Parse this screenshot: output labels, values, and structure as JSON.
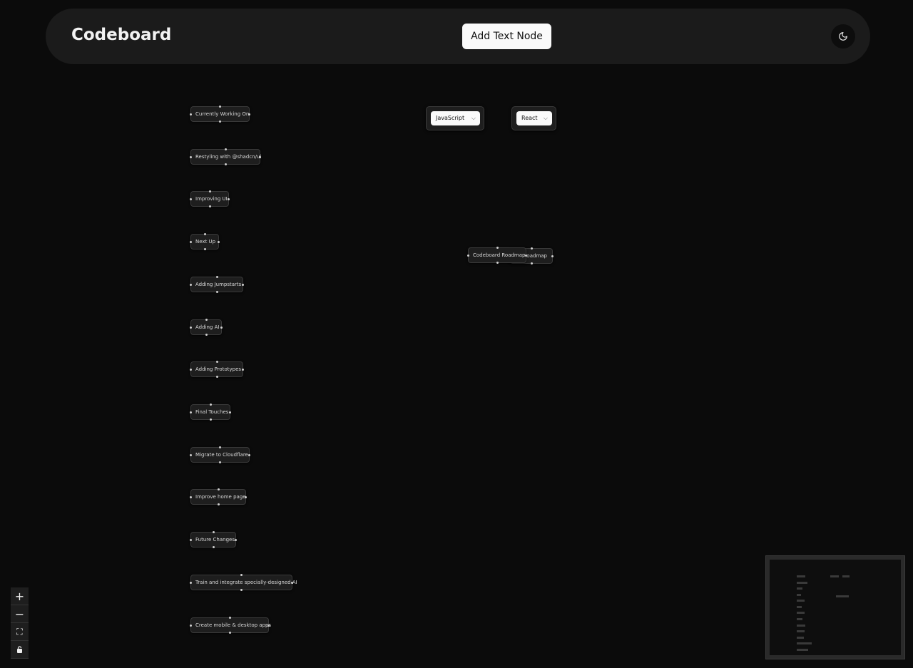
{
  "header": {
    "brand": "Codeboard",
    "add_text_node_label": "Add Text Node",
    "theme_icon": "moon-icon"
  },
  "nodes": [
    "Currently Working On",
    "Restyling with @shadcn/ui",
    "Improving UI",
    "Next Up",
    "Adding Jumpstarts",
    "Adding AI",
    "Adding Prototypes",
    "Final Touches",
    "Migrate to Cloudflare",
    "Improve home page",
    "Future Changes",
    "Train and integrate specially-designed AI",
    "Create mobile & desktop apps"
  ],
  "selects": {
    "language": "JavaScript",
    "framework": "React"
  },
  "roadmap": {
    "front_label": "Codeboard Roadmap",
    "back_label": "Roadmap"
  },
  "controls": {
    "zoom_in": "+",
    "zoom_out": "−",
    "fit_view": "⛶",
    "lock_icon": "lock-icon"
  },
  "colors": {
    "background": "#0b0b0b",
    "header": "#1b1b1b",
    "node": "#1e1e1e",
    "button": "#fafafa"
  }
}
